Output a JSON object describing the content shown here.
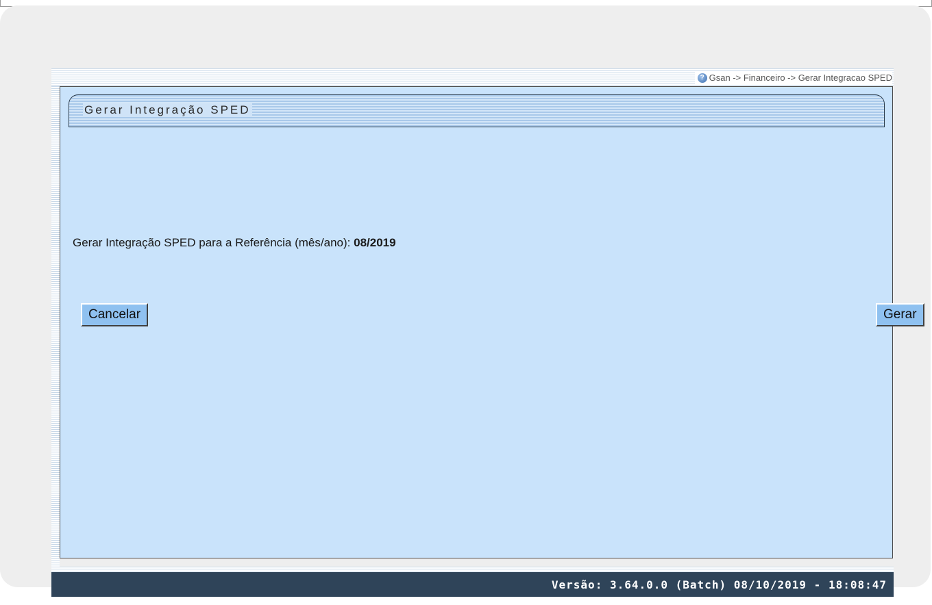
{
  "breadcrumb": "Gsan -> Financeiro -> Gerar Integracao SPED",
  "page_title": "Gerar Integração SPED",
  "info": {
    "label": "Gerar Integração SPED para a Referência (mês/ano):",
    "value": "08/2019"
  },
  "buttons": {
    "cancel_label": "Cancelar",
    "submit_label": "Gerar"
  },
  "footer": {
    "version_text": "Versão: 3.64.0.0 (Batch) 08/10/2019 - 18:08:47"
  },
  "icons": {
    "help": "help-icon"
  },
  "colors": {
    "panel_bg": "#c9e3fb",
    "button_bg": "#8fc1f0",
    "footer_bg": "#2f4459",
    "outer_bg": "#eeeeee"
  }
}
